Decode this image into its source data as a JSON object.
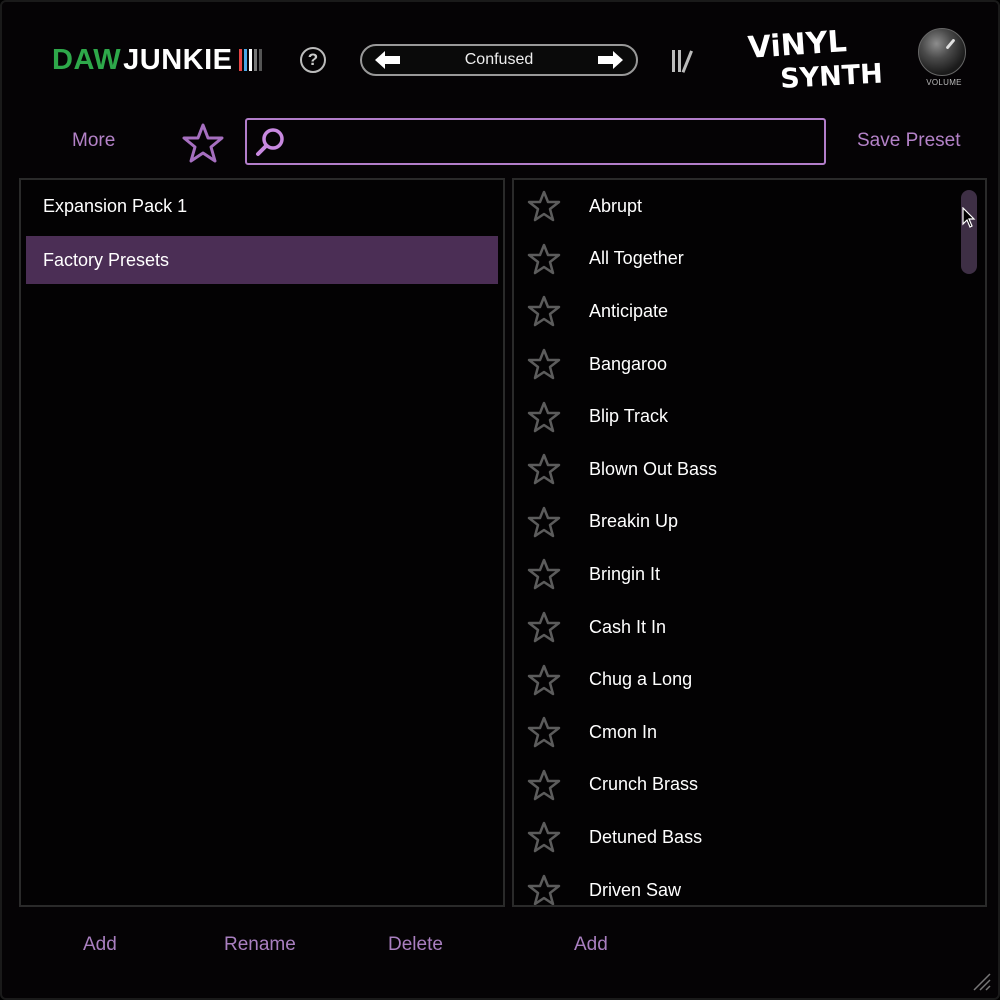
{
  "header": {
    "brand_part1": "DAW",
    "brand_part2": "JUNKIE",
    "brand_bar_colors": [
      "#e84545",
      "#4aa8e8",
      "#ffffff",
      "#777777",
      "#555555"
    ],
    "help_label": "?",
    "current_preset": "Confused",
    "volume_label": "VOLUME"
  },
  "toolbar": {
    "more_label": "More",
    "search_value": "",
    "save_preset_label": "Save Preset"
  },
  "folders": [
    {
      "label": "Expansion Pack 1",
      "selected": false
    },
    {
      "label": "Factory Presets",
      "selected": true
    }
  ],
  "presets": [
    "Abrupt",
    "All Together",
    "Anticipate",
    "Bangaroo",
    "Blip Track",
    "Blown Out Bass",
    "Breakin Up",
    "Bringin It",
    "Cash It In",
    "Chug a Long",
    "Cmon In",
    "Crunch Brass",
    "Detuned Bass",
    "Driven Saw"
  ],
  "footer": {
    "folder_add": "Add",
    "folder_rename": "Rename",
    "folder_delete": "Delete",
    "preset_add": "Add"
  },
  "colors": {
    "accent": "#b27dca",
    "selected_bg": "#4b2e55",
    "brand_green": "#2ea84a"
  }
}
